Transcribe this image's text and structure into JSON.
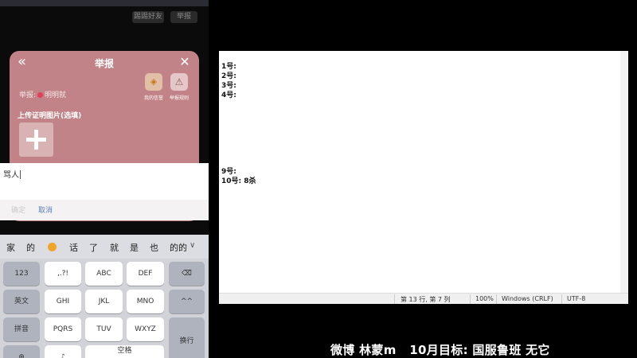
{
  "phone": {
    "top_buttons": [
      "踢踢好友",
      "举报"
    ],
    "modal": {
      "title": "举报",
      "target_label": "举报:",
      "target_name": "明明就",
      "quick_actions": [
        {
          "label": "我的信誉",
          "icon": "shield-badge-icon"
        },
        {
          "label": "举报规则",
          "icon": "warning-triangle-icon"
        }
      ],
      "upload_label": "上传证明图片(选填)"
    },
    "input": {
      "value": "骂人"
    },
    "actions": {
      "disabled": "确定",
      "cancel": "取消"
    },
    "keyboard": {
      "suggestions": [
        "家",
        "的",
        "话",
        "了",
        "就",
        "是",
        "也",
        "的的"
      ],
      "row1": [
        "123",
        ",.?!",
        "ABC",
        "DEF"
      ],
      "row2": [
        "英文",
        "GHI",
        "JKL",
        "MNO",
        "^^"
      ],
      "row3": [
        "拼音",
        "PQRS",
        "TUV",
        "WXYZ"
      ],
      "enter": "换行",
      "space": "空格"
    }
  },
  "notepad": {
    "lines": [
      "1号:",
      "2号:",
      "3号:",
      "4号:",
      "",
      "",
      "",
      "",
      "",
      "",
      "",
      "9号:",
      "10号: 8杀"
    ],
    "status": {
      "position": "第 13 行, 第 7 列",
      "zoom": "100%",
      "line_ending": "Windows (CRLF)",
      "encoding": "UTF-8"
    }
  },
  "caption": "微博 林蒙m   10月目标: 国服鲁班 无它"
}
